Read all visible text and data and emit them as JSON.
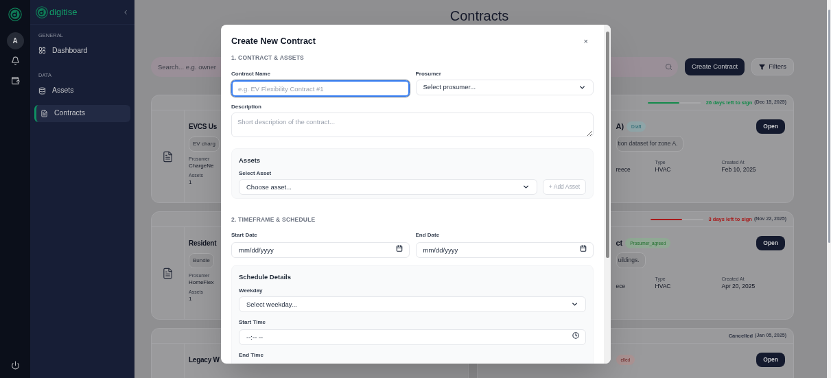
{
  "rail": {
    "avatar": "A"
  },
  "sidebar": {
    "brand": "digitise",
    "sections": [
      {
        "heading": "GENERAL",
        "items": [
          {
            "label": "Dashboard",
            "selected": false
          }
        ]
      },
      {
        "heading": "DATA",
        "items": [
          {
            "label": "Assets",
            "selected": false
          },
          {
            "label": "Contracts",
            "selected": true
          }
        ]
      }
    ]
  },
  "page": {
    "title": "Contracts",
    "search": {
      "placeholder": "Search... e.g. owner"
    },
    "create_button": "Create Contract",
    "filters_button": "Filters"
  },
  "contracts": [
    {
      "left": {
        "title": "EVCS Us",
        "description": "EV charg",
        "prosumer_label": "Prosumer",
        "prosumer": "ChargeNe",
        "assets_label": "Assets",
        "assets": "1"
      },
      "right": {
        "header": {
          "kind": "deadline",
          "level": 0.6,
          "color": "#138a4a",
          "text": "26 days left to sign",
          "date": "(Dec 15, 2025)"
        },
        "title": "A)",
        "badge": {
          "text": "Draft",
          "color": "#8fa5a8"
        },
        "open_button": "Open",
        "description": "tion dataset for zone A.",
        "fields": [
          {
            "value": "reece"
          },
          {
            "label": "Type",
            "value": "HVAC"
          },
          {
            "label": "Created At",
            "value": "Feb 10, 2025"
          }
        ]
      }
    },
    {
      "left": {
        "title": "Resident",
        "description": "Bundle",
        "prosumer_label": "Prosumer",
        "prosumer": "HomeFlex",
        "assets_label": "Assets",
        "assets": "1"
      },
      "right": {
        "header": {
          "kind": "deadline",
          "level": 0.6,
          "color": "#a81a1a",
          "text": "3 days left to sign",
          "date": "(Nov 22, 2025)"
        },
        "title": "ct",
        "badge": {
          "text": "Prosumer_agreed",
          "color": "#90a994"
        },
        "open_button": "Open",
        "description": "uildings.",
        "fields": [
          {
            "value": "ece"
          },
          {
            "label": "Type",
            "value": "HVAC"
          },
          {
            "label": "Created At",
            "value": "Apr 20, 2025"
          }
        ]
      }
    },
    {
      "left": {
        "title": "Legacy W"
      },
      "right": {
        "header": {
          "kind": "closed",
          "color": "#2a3040",
          "text": "Cancelled",
          "date": "(Jan 05, 2025)"
        },
        "badge": {
          "text": "elled",
          "color": "#ab9393"
        },
        "open_button": "Open"
      }
    }
  ],
  "modal": {
    "title": "Create New Contract",
    "close": "×",
    "section_1": {
      "heading": "1. CONTRACT & ASSETS",
      "contract_name": {
        "label": "Contract Name",
        "placeholder": "e.g. EV Flexibility Contract #1",
        "focused": true
      },
      "prosumer": {
        "label": "Prosumer",
        "value": "Select prosumer..."
      },
      "description": {
        "label": "Description",
        "placeholder": "Short description of the contract..."
      },
      "assets_panel": {
        "title": "Assets",
        "select_label": "Select Asset",
        "select_value": "Choose asset...",
        "add_button": {
          "label": "+ Add Asset",
          "disabled": true
        }
      }
    },
    "section_2": {
      "heading": "2. TIMEFRAME & SCHEDULE",
      "start_date": {
        "label": "Start Date",
        "placeholder": "mm/dd/yyyy"
      },
      "end_date": {
        "label": "End Date",
        "placeholder": "mm/dd/yyyy"
      },
      "schedule_panel": {
        "title": "Schedule Details",
        "weekday": {
          "label": "Weekday",
          "value": "Select weekday..."
        },
        "start_time": {
          "label": "Start Time",
          "placeholder": "--:-- --"
        },
        "end_time": {
          "label": "End Time"
        }
      }
    }
  }
}
